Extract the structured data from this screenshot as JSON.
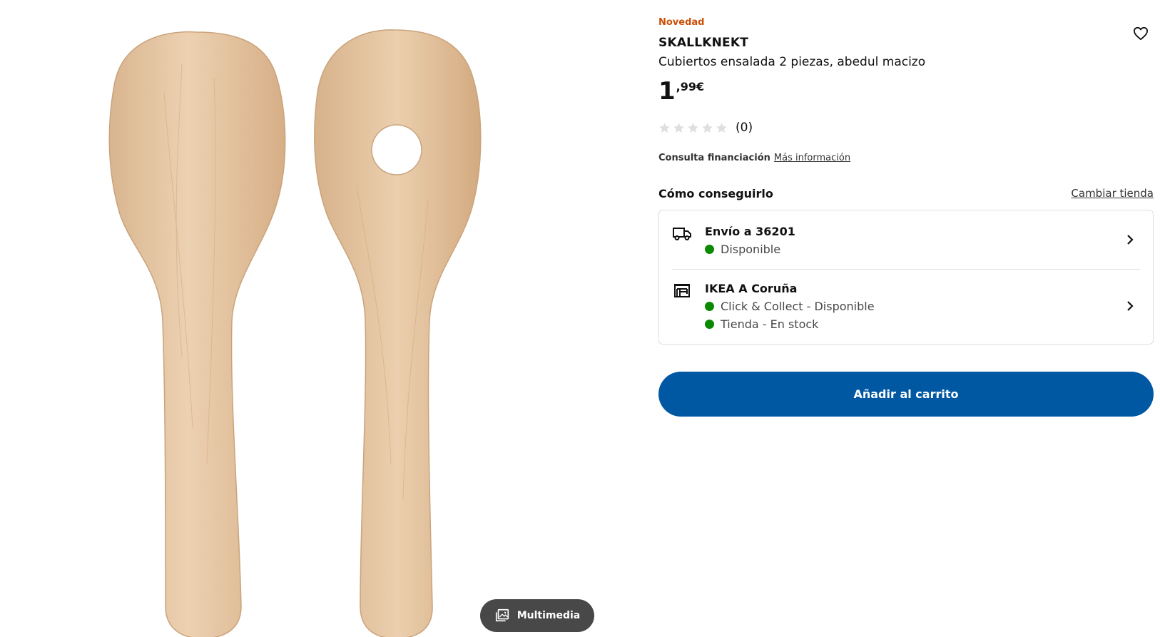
{
  "gallery": {
    "image_alt": "Cubiertos ensalada de madera",
    "media_button_label": "Multimedia",
    "media_icon": "image-gallery-icon"
  },
  "product": {
    "badge": "Novedad",
    "name": "SKALLKNEKT",
    "description": "Cubiertos ensalada 2 piezas, abedul macizo",
    "price_integer": "1",
    "price_decimal": ",99€",
    "rating_count": "(0)",
    "rating_value": 0,
    "rating_max": 5,
    "favourite_icon": "heart-icon"
  },
  "finance": {
    "label": "Consulta financiación",
    "link": "Más información"
  },
  "availability": {
    "title": "Cómo conseguirlo",
    "change_store": "Cambiar tienda",
    "delivery": {
      "icon": "truck-icon",
      "title": "Envío a 36201",
      "status": "Disponible",
      "status_color": "#0a8a00"
    },
    "store": {
      "icon": "store-icon",
      "title": "IKEA A Coruña",
      "status_collect": "Click & Collect - Disponible",
      "status_stock": "Tienda - En stock",
      "status_color": "#0a8a00"
    }
  },
  "cart": {
    "label": "Añadir al carrito",
    "color": "#0058a3"
  },
  "colors": {
    "badge_new": "#ca5008",
    "wood": "#e2c19c"
  }
}
